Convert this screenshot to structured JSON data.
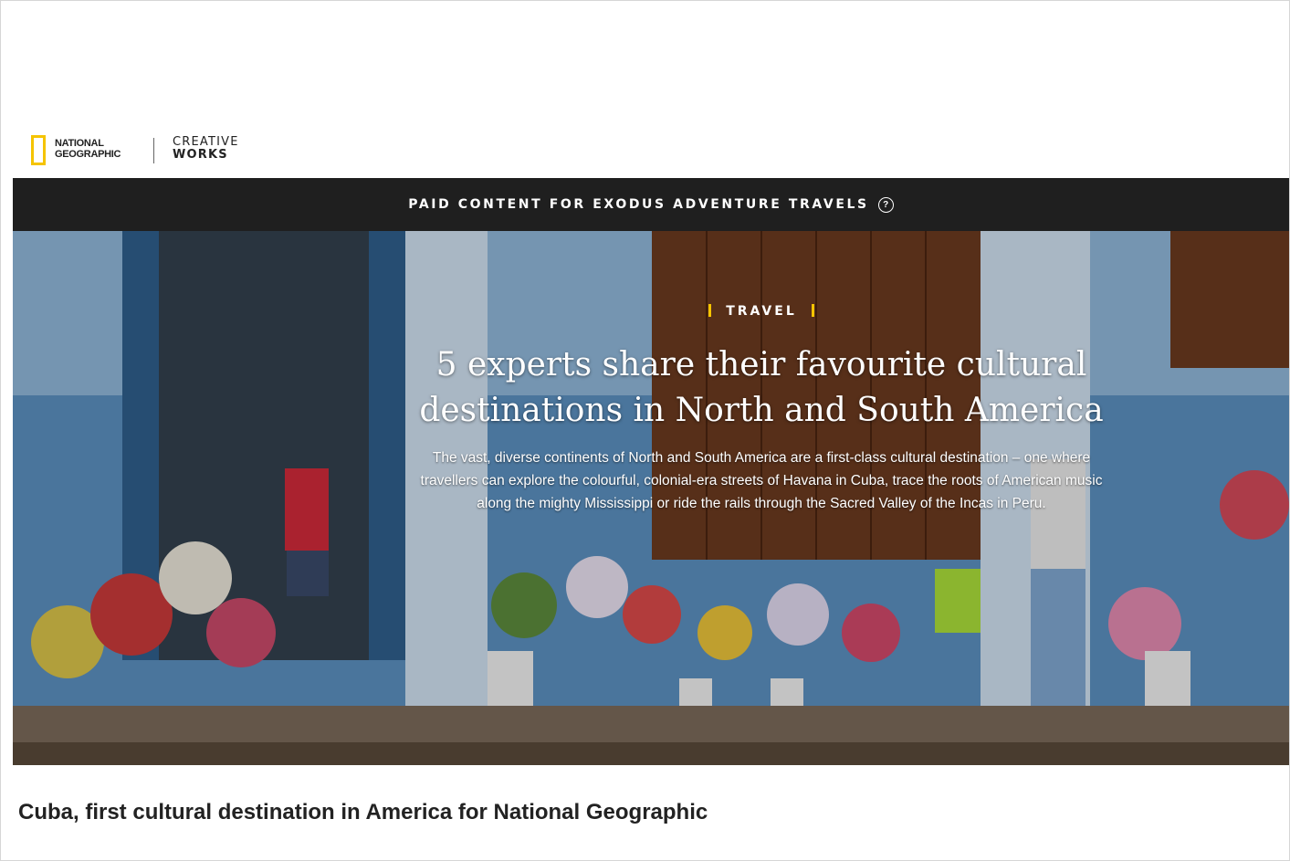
{
  "header": {
    "brand_line1": "NATIONAL",
    "brand_line2": "GEOGRAPHIC",
    "partner_line1": "CREATIVE",
    "partner_line2": "WORKS"
  },
  "sponsor_bar": {
    "text": "PAID CONTENT FOR EXODUS ADVENTURE TRAVELS",
    "icon": "question-circle-icon"
  },
  "hero": {
    "kicker": "TRAVEL",
    "headline_line1": "5 experts share their favourite cultural",
    "headline_line2": "destinations in North and South America",
    "standfirst": "The vast, diverse continents of North and South America are a first-class cultural destination – one where travellers can explore the colourful, colonial-era streets of Havana in Cuba, trace the roots of American music along the mighty Mississippi or ride the rails through the Sacred Valley of the Incas in Peru.",
    "accent_color": "#f5c400"
  },
  "caption": "Cuba, first cultural destination in America for National Geographic"
}
